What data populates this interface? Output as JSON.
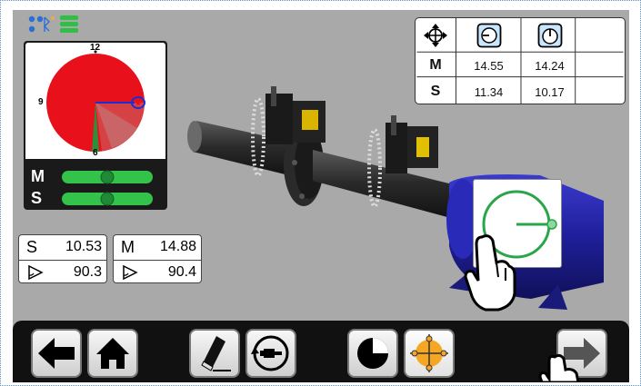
{
  "colors": {
    "background": "#a9a9a9",
    "radar_red": "#e8101a",
    "radar_green": "#2d8f3a",
    "level_green": "#33c24a",
    "target_green": "#2aa64a",
    "accent_orange": "#f5a623",
    "motor_blue": "#22229a"
  },
  "status": {
    "icons": [
      "bluetooth-icon",
      "battery-icon"
    ]
  },
  "radar": {
    "clock_labels": {
      "top": "12",
      "left": "9",
      "bottom": "6"
    },
    "levels": [
      {
        "label": "M",
        "bubble_position": 0.5
      },
      {
        "label": "S",
        "bubble_position": 0.5
      }
    ]
  },
  "results": {
    "header_icons": [
      "crosshair-move-icon",
      "horizontal-gauge-icon",
      "vertical-gauge-icon"
    ],
    "rows": [
      {
        "label": "M",
        "values": [
          "14.55",
          "14.24"
        ]
      },
      {
        "label": "S",
        "values": [
          "11.34",
          "10.17"
        ]
      }
    ]
  },
  "value_boxes": [
    {
      "letter": "S",
      "value": "10.53",
      "angle": "90.3"
    },
    {
      "letter": "M",
      "value": "14.88",
      "angle": "90.4"
    }
  ],
  "toolbar": {
    "buttons": [
      {
        "name": "back-button",
        "icon": "arrow-left-icon"
      },
      {
        "name": "home-button",
        "icon": "home-icon"
      },
      {
        "name": "clear-button",
        "icon": "eraser-icon"
      },
      {
        "name": "rotate-machine-button",
        "icon": "rotate-machine-icon"
      },
      {
        "name": "clock-view-button",
        "icon": "half-circle-icon"
      },
      {
        "name": "target-view-button",
        "icon": "orange-crosshair-icon"
      },
      {
        "name": "next-button",
        "icon": "arrow-right-icon"
      }
    ]
  }
}
